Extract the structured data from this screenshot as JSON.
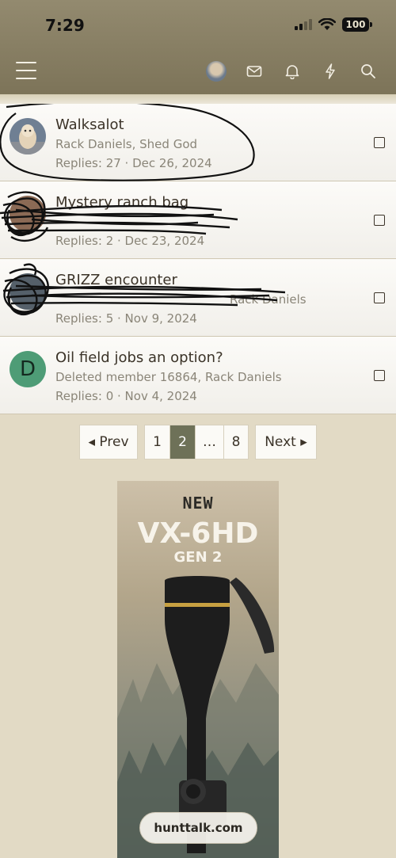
{
  "status_bar": {
    "time": "7:29",
    "battery": "100"
  },
  "nav": {
    "icons": [
      "menu-icon",
      "avatar",
      "mail-icon",
      "bell-icon",
      "lightning-icon",
      "search-icon"
    ]
  },
  "threads": [
    {
      "title": "Walksalot",
      "participants": "Rack Daniels, Shed God",
      "replies": "Replies: 27 · Dec 26, 2024"
    },
    {
      "title": "Mystery ranch bag",
      "participants": "",
      "replies": "Replies: 2 · Dec 23, 2024"
    },
    {
      "title": "GRIZZ encounter",
      "participants": "Rack Daniels",
      "replies": "Replies: 5 · Nov 9, 2024"
    },
    {
      "title": "Oil field jobs an option?",
      "participants": "Deleted member 16864, Rack Daniels",
      "replies": "Replies: 0 · Nov 4, 2024",
      "avatar_letter": "D"
    }
  ],
  "pagination": {
    "prev": "◂ Prev",
    "pages": [
      "1",
      "2",
      "…",
      "8"
    ],
    "current": "2",
    "next": "Next ▸"
  },
  "ad": {
    "new": "NEW",
    "model": "VX-6HD",
    "gen": "GEN 2"
  },
  "site": "hunttalk.com",
  "colors": {
    "header": "#7c7358",
    "page_bg": "#e2dac5",
    "active_page": "#6e7158",
    "avatar_d": "#4e9c76"
  }
}
